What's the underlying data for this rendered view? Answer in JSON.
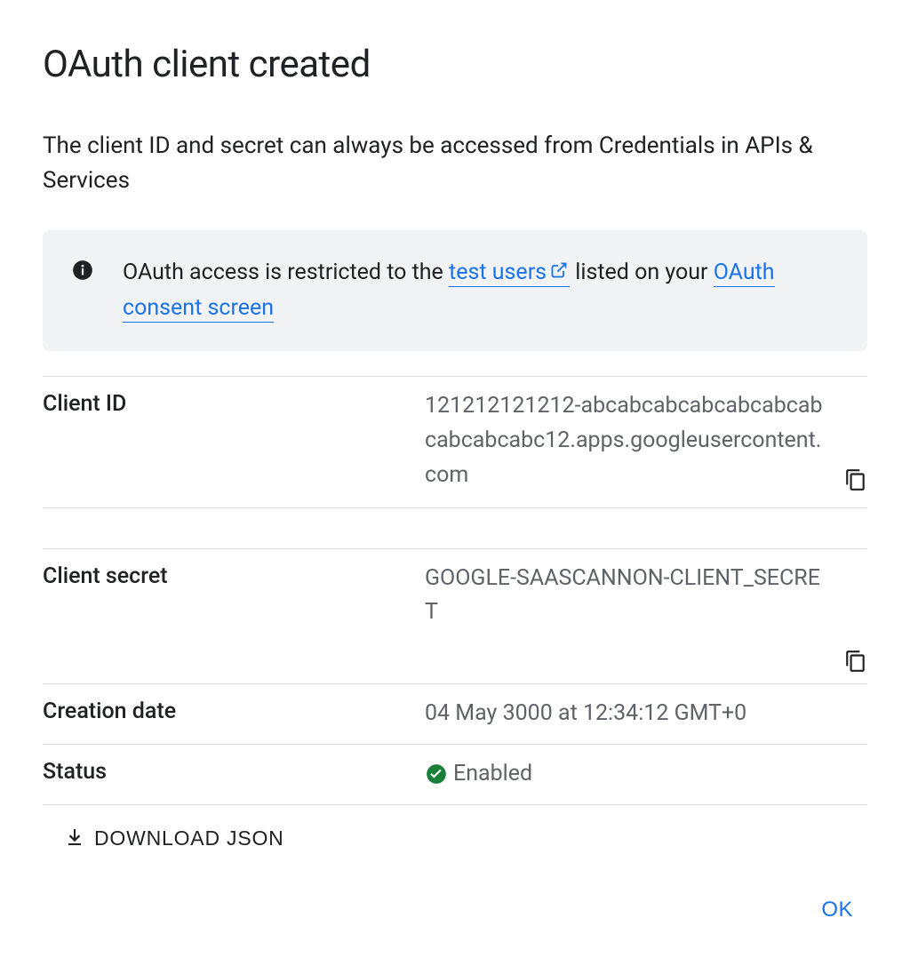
{
  "dialog": {
    "title": "OAuth client created",
    "subtitle": "The client ID and secret can always be accessed from Credentials in APIs & Services"
  },
  "banner": {
    "prefix": "OAuth access is restricted to the ",
    "link1": "test users",
    "middle": " listed on your ",
    "link2": "OAuth consent screen"
  },
  "details": {
    "client_id_label": "Client ID",
    "client_id_value": "121212121212-abcabcabcabcabcabcabcabcabcabc12.apps.googleusercontent.com",
    "client_secret_label": "Client secret",
    "client_secret_value": "GOOGLE-SAASCANNON-CLIENT_SECRET",
    "creation_date_label": "Creation date",
    "creation_date_value": "04 May 3000 at 12:34:12 GMT+0",
    "status_label": "Status",
    "status_value": "Enabled"
  },
  "actions": {
    "download_label": "DOWNLOAD JSON",
    "ok_label": "OK"
  }
}
